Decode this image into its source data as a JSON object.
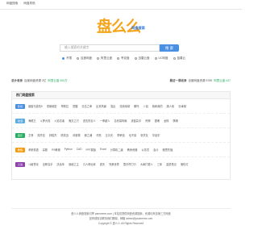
{
  "topnav": {
    "links": [
      "网盘搜索",
      "网盘导航"
    ]
  },
  "logo": {
    "main": "盘么么",
    "sub": "网盘搜索"
  },
  "search": {
    "placeholder": "输入搜索的关键字",
    "button": "搜 索"
  },
  "filters": [
    "不限",
    "百度网盘",
    "阿里云盘",
    "夸克盘",
    "迅雷云盘",
    "UC网盘",
    "蓝奏云"
  ],
  "stats": {
    "left_label": "总计收录",
    "left_text": "百度网盘资源 2亿",
    "left_hl": "阿里云盘 300万",
    "right_label": "最近一周收录",
    "right_text": "百度网盘资源 5789",
    "right_hl": "阿里云盘 437"
  },
  "hot": {
    "title": "热门网盘搜索",
    "rows": [
      {
        "cat": "影视",
        "color": "#4a90e2",
        "items": [
          "速度与激情9",
          "重案秘密",
          "哥斯拉",
          "觉醒",
          "无名之辈",
          "反贪风暴",
          "混乱",
          "流浪地球",
          "哪吒",
          "八佰",
          "我和我的",
          "唐人街",
          "长津湖"
        ]
      },
      {
        "cat": "动漫",
        "color": "#5dade2",
        "items": [
          "海贼王",
          "斗罗大陆",
          "火影忍者",
          "鬼灭之刃",
          "进击的巨人",
          "一拳超人",
          "名侦探柯南",
          "灌篮高手",
          "死神",
          "银魂",
          "龙珠",
          "棋魂"
        ]
      },
      {
        "cat": "音乐",
        "color": "#27ae60",
        "items": [
          "王菲",
          "周杰伦",
          "林俊杰",
          "陈奕迅",
          "邓紫棋",
          "薛之谦",
          "许嵩",
          "五月天",
          "李荣浩",
          "毛不易",
          "张学友",
          "华晨宇"
        ]
      },
      {
        "cat": "教程",
        "color": "#f39c12",
        "items": [
          "考研英语",
          "高数",
          "PS教程",
          "Python",
          "CAD",
          "PPT模板",
          "Excel",
          "计算机二级",
          "教师资格",
          "公务员",
          "会计",
          "雅思托福"
        ]
      },
      {
        "cat": "小说",
        "color": "#8e44ad",
        "items": [
          "斗破苍穹",
          "全职高手",
          "庆余年",
          "诡秘之主",
          "凡人修仙传",
          "遮天",
          "完美世界",
          "雪中悍刀行",
          "大奉打更人",
          "三体",
          "盗墓笔记",
          "鬼吹灯"
        ]
      }
    ]
  },
  "footer": {
    "line1": "盘么么网盘搜索引擎 panmeme.com | 本站仅提供网盘资源搜索，资源均来自第三方网盘",
    "line2": "如有侵权请联系我们删除，邮箱 admin@panmeme.com",
    "line3": "Copyright © 盘么么 All Rights Reserved"
  }
}
